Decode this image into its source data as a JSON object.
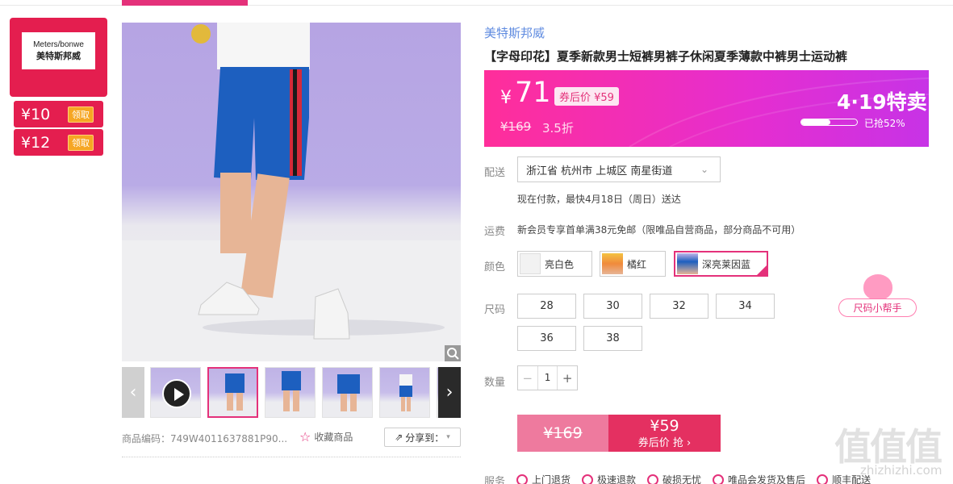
{
  "brand_card": {
    "logo_line1": "Meters/bonwe",
    "logo_line2": "美特斯邦威",
    "coupons": [
      {
        "amount": "¥10",
        "action": "领取"
      },
      {
        "amount": "¥12",
        "action": "领取"
      }
    ]
  },
  "gallery": {
    "product_code": "商品编码：749W4011637881P90...",
    "favorite_label": "收藏商品",
    "share_label": "分享到：",
    "prev_arrow": "‹",
    "next_arrow": "›"
  },
  "product": {
    "brand": "美特斯邦威",
    "title": "【字母印花】夏季新款男士短裤男裤子休闲夏季薄款中裤男士运动裤"
  },
  "price": {
    "currency": "¥",
    "current": "71",
    "after_coupon_tag": "券后价 ¥59",
    "original": "¥169",
    "discount": "3.5折",
    "sale_title": "4·19特卖",
    "sold_text": "已抢52%",
    "sold_fraction": 0.52
  },
  "delivery": {
    "label": "配送",
    "address": "浙江省 杭州市 上城区 南星街道",
    "eta": "现在付款，最快4月18日（周日）送达"
  },
  "shipping": {
    "label": "运费",
    "text": "新会员专享首单满38元免邮（限唯品自营商品，部分商品不可用）"
  },
  "colors": {
    "label": "颜色",
    "options": [
      {
        "name": "亮白色"
      },
      {
        "name": "橘红"
      },
      {
        "name": "深亮莱因蓝"
      }
    ]
  },
  "sizes": {
    "label": "尺码",
    "options": [
      "28",
      "30",
      "32",
      "34",
      "36",
      "38"
    ]
  },
  "size_helper": "尺码小帮手",
  "quantity": {
    "label": "数量",
    "value": "1",
    "minus": "−",
    "plus": "+"
  },
  "buy": {
    "original_price": "¥169",
    "coupon_price": "¥59",
    "coupon_action": "券后价 抢 ›"
  },
  "services": {
    "label": "服务",
    "items": [
      "上门退货",
      "极速退款",
      "破损无忧",
      "唯品会发货及售后",
      "顺丰配送"
    ]
  },
  "watermark": {
    "main": "值值值",
    "sub": "zhizhizhi.com"
  }
}
